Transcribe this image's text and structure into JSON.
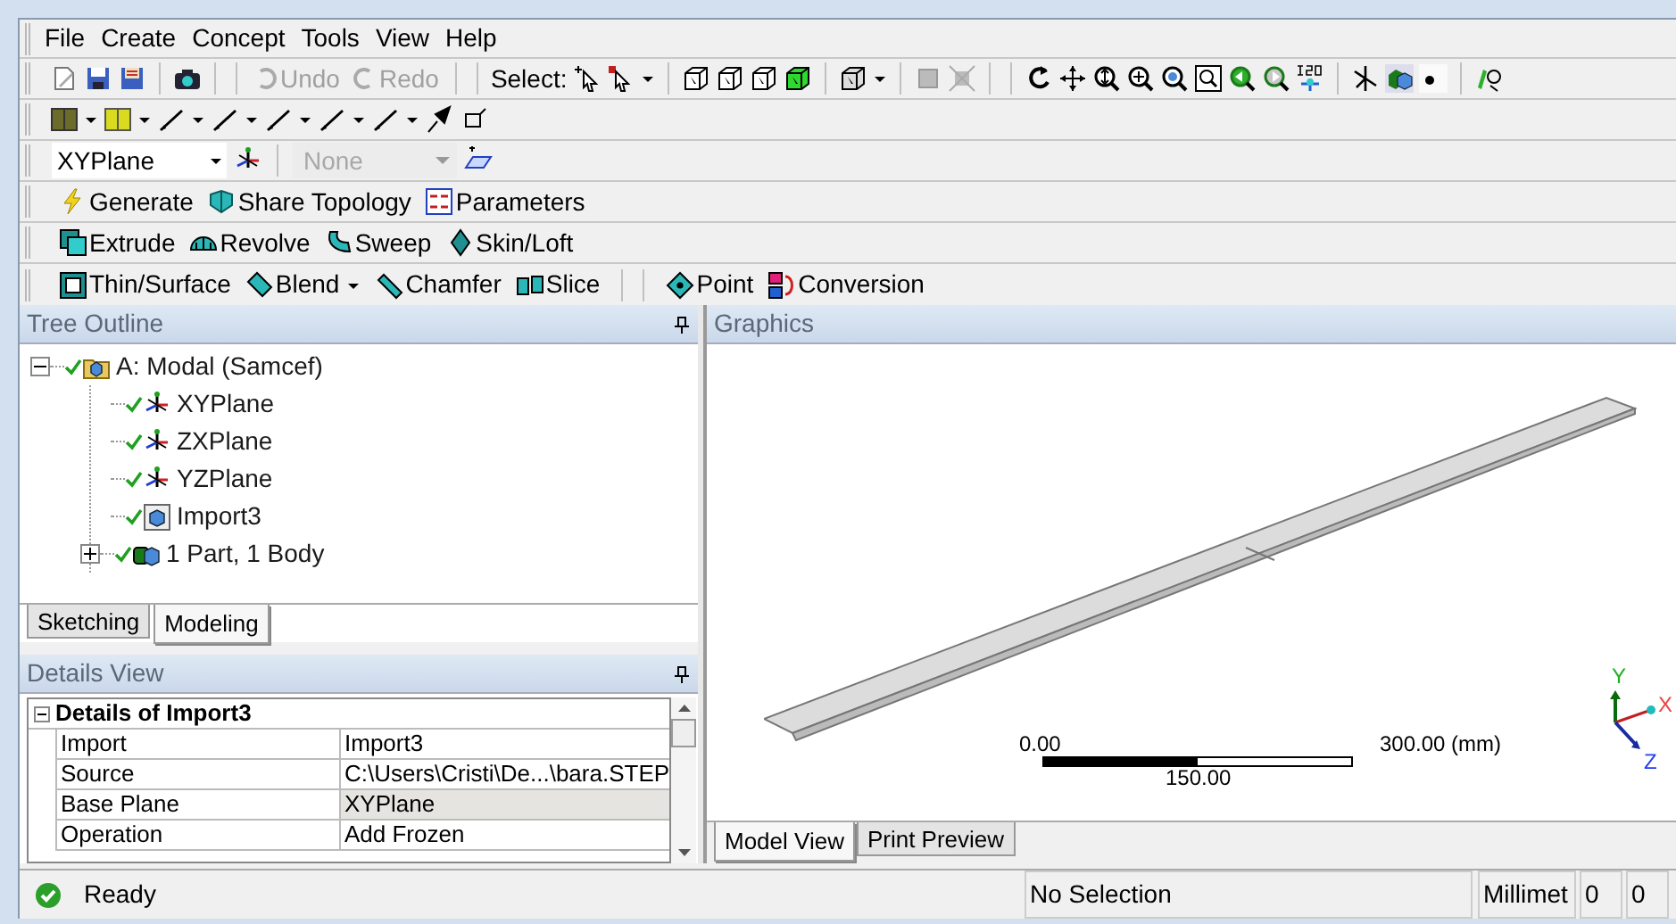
{
  "menu": [
    "File",
    "Create",
    "Concept",
    "Tools",
    "View",
    "Help"
  ],
  "edit_toolbar": {
    "undo": {
      "label": "Undo",
      "disabled": true
    },
    "redo": {
      "label": "Redo",
      "disabled": true
    },
    "select_label": "Select:"
  },
  "plane_toolbar": {
    "plane": "XYPlane",
    "sketch": {
      "value": "None",
      "disabled": true
    }
  },
  "feature_toolbars": [
    [
      {
        "kind": "button",
        "label": "Generate",
        "dropdown": false
      },
      {
        "kind": "button",
        "label": "Share Topology",
        "dropdown": false
      },
      {
        "kind": "button",
        "label": "Parameters",
        "dropdown": false
      }
    ],
    [
      {
        "kind": "button",
        "label": "Extrude",
        "dropdown": false
      },
      {
        "kind": "button",
        "label": "Revolve",
        "dropdown": false
      },
      {
        "kind": "button",
        "label": "Sweep",
        "dropdown": false
      },
      {
        "kind": "button",
        "label": "Skin/Loft",
        "dropdown": false
      }
    ],
    [
      {
        "kind": "button",
        "label": "Thin/Surface",
        "dropdown": false
      },
      {
        "kind": "button",
        "label": "Blend",
        "dropdown": true
      },
      {
        "kind": "button",
        "label": "Chamfer",
        "dropdown": false
      },
      {
        "kind": "button",
        "label": "Slice",
        "dropdown": false
      },
      {
        "kind": "separator"
      },
      {
        "kind": "button",
        "label": "Point",
        "dropdown": false
      },
      {
        "kind": "button",
        "label": "Conversion",
        "dropdown": false
      }
    ]
  ],
  "tree_outline": {
    "title": "Tree Outline",
    "root": {
      "label": "A: Modal (Samcef)",
      "kind": "model",
      "valid": true,
      "expanded": true,
      "children": [
        {
          "label": "XYPlane",
          "kind": "plane",
          "valid": true
        },
        {
          "label": "ZXPlane",
          "kind": "plane",
          "valid": true
        },
        {
          "label": "YZPlane",
          "kind": "plane",
          "valid": true
        },
        {
          "label": "Import3",
          "kind": "import",
          "valid": true
        },
        {
          "label": "1 Part, 1 Body",
          "kind": "body",
          "valid": true,
          "expanded": false
        }
      ]
    }
  },
  "panel_tabs": [
    {
      "label": "Sketching",
      "selected": false
    },
    {
      "label": "Modeling",
      "selected": true
    }
  ],
  "details_view": {
    "title": "Details View",
    "section": {
      "title": "Details of Import3",
      "expanded": true,
      "rows": [
        {
          "label": "Import",
          "value": "Import3",
          "selected": false
        },
        {
          "label": "Source",
          "value": "C:\\Users\\Cristi\\De...\\bara.STEP",
          "selected": false
        },
        {
          "label": "Base Plane",
          "value": "XYPlane",
          "selected": true
        },
        {
          "label": "Operation",
          "value": "Add Frozen",
          "selected": false
        }
      ]
    }
  },
  "graphics": {
    "title": "Graphics",
    "scale": {
      "start": "0.00",
      "end": "300.00 (mm)",
      "mid": "150.00"
    },
    "axes": {
      "x": "X",
      "y": "Y",
      "z": "Z"
    },
    "tabs": [
      {
        "label": "Model View",
        "selected": true
      },
      {
        "label": "Print Preview",
        "selected": false
      }
    ]
  },
  "status_bar": {
    "message": "Ready",
    "selection": "No Selection",
    "units": "Millimet",
    "field_1": "0",
    "field_2": "0"
  }
}
